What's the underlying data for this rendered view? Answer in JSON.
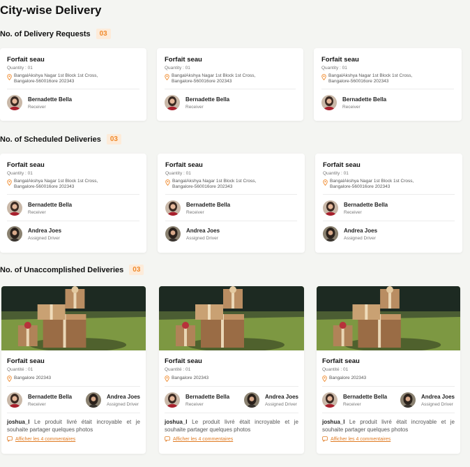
{
  "page_title": "City-wise Delivery",
  "sections": {
    "requests": {
      "title": "No. of Delivery Requests",
      "count": "03"
    },
    "scheduled": {
      "title": "No. of Scheduled Deliveries",
      "count": "03"
    },
    "unaccomplished": {
      "title": "No. of Unaccomplished Deliveries",
      "count": "03"
    }
  },
  "request_card": {
    "title": "Forfait seau",
    "quantity": "Quantity : 01",
    "address_line1": "BangalAkshya Nagar 1st Block 1st Cross,",
    "address_line2": "Bangalore-560016ore 202343",
    "receiver_name": "Bernadette Bella",
    "receiver_role": "Receiver"
  },
  "scheduled_card": {
    "title": "Forfait seau",
    "quantity": "Quantity : 01",
    "address_line1": "BangalAkshya Nagar 1st Block 1st Cross,",
    "address_line2": "Bangalore-560016ore 202343",
    "receiver_name": "Bernadette Bella",
    "receiver_role": "Receiver",
    "driver_name": "Andrea Joes",
    "driver_role": "Assigned Driver"
  },
  "unaccomplished_card": {
    "title": "Forfait seau",
    "quantity": "Quantité : 01",
    "address": "Bangalore 202343",
    "receiver_name": "Bernadette Bella",
    "receiver_role": "Receiver",
    "driver_name": "Andrea Joes",
    "driver_role": "Assigned Driver",
    "comment_user": "joshua_l",
    "comment_text": "Le produit livré était incroyable et je souhaite partager quelques photos",
    "view_comments": "Afficher les 4 commentaires"
  },
  "colors": {
    "accent": "#f08a2c",
    "badge_bg": "#fdebd9",
    "background": "#f4f5f2"
  }
}
